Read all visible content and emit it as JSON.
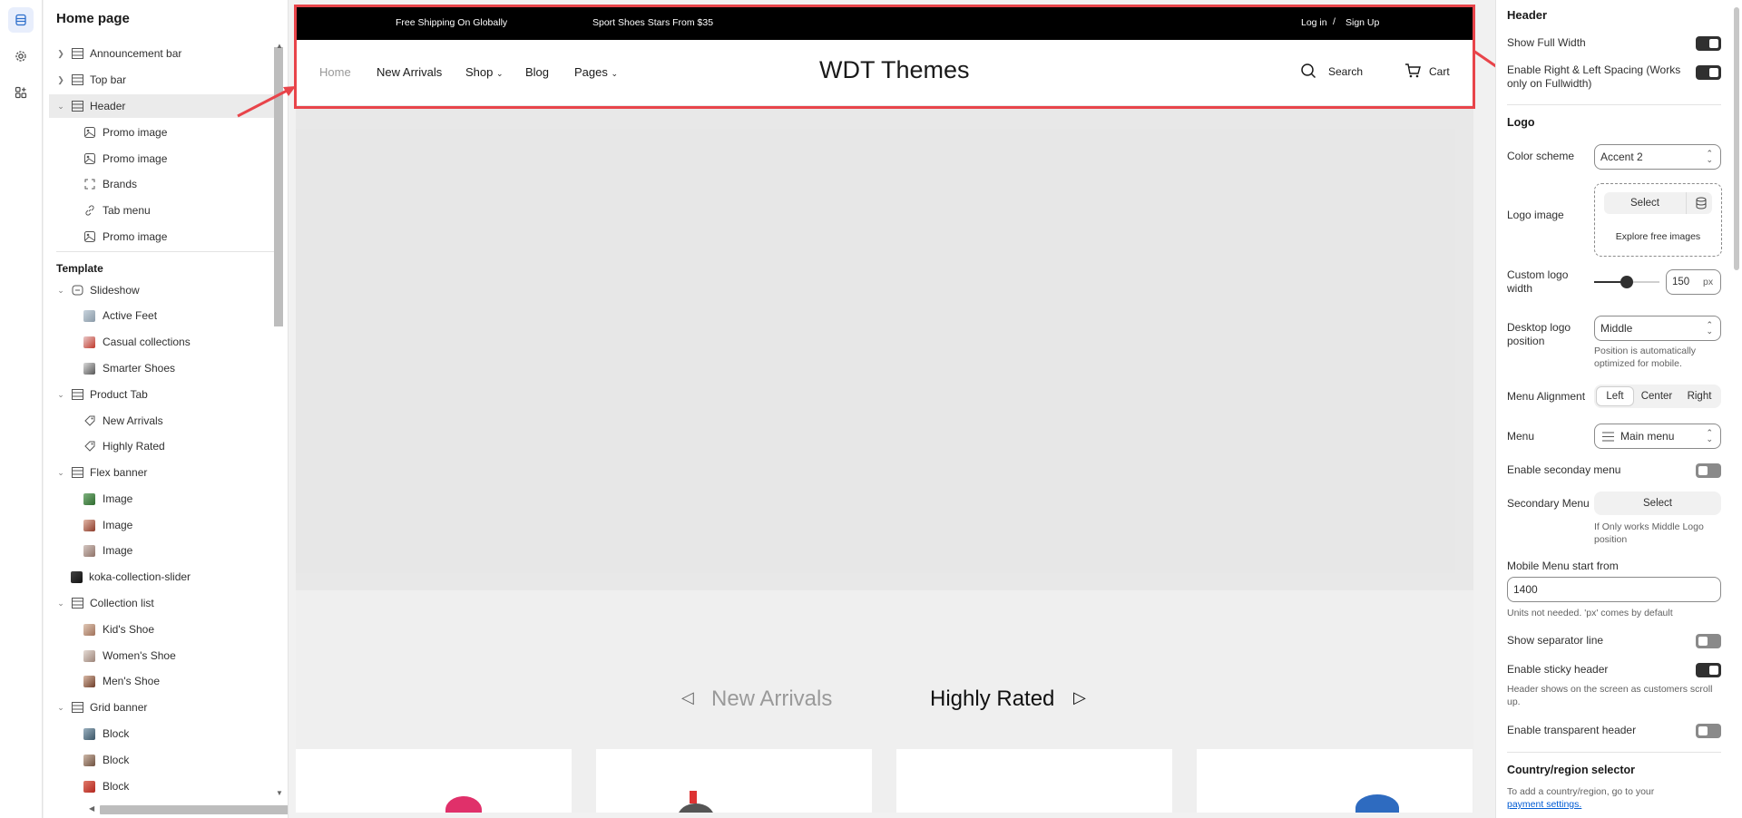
{
  "sidebar_rail": {
    "icons": [
      "sections-icon",
      "settings-gear-icon",
      "apps-icon"
    ]
  },
  "left_panel": {
    "title": "Home page",
    "header_items": [
      {
        "label": "Announcement bar"
      },
      {
        "label": "Top bar"
      },
      {
        "label": "Header"
      }
    ],
    "header_children": [
      {
        "label": "Promo image"
      },
      {
        "label": "Promo image"
      },
      {
        "label": "Brands"
      },
      {
        "label": "Tab menu"
      },
      {
        "label": "Promo image"
      }
    ],
    "template_label": "Template",
    "template_items": [
      {
        "label": "Slideshow",
        "children": [
          "Active Feet",
          "Casual collections",
          "Smarter Shoes"
        ]
      },
      {
        "label": "Product Tab",
        "children": [
          "New Arrivals",
          "Highly Rated"
        ]
      },
      {
        "label": "Flex banner",
        "children": [
          "Image",
          "Image",
          "Image"
        ]
      },
      {
        "label": "koka-collection-slider",
        "children": []
      },
      {
        "label": "Collection list",
        "children": [
          "Kid's Shoe",
          "Women's Shoe",
          "Men's Shoe"
        ]
      },
      {
        "label": "Grid banner",
        "children": [
          "Block",
          "Block",
          "Block"
        ]
      }
    ]
  },
  "preview": {
    "topbar": {
      "msg1": "Free Shipping On Globally",
      "msg2": "Sport Shoes Stars From $35",
      "login": "Log in",
      "sep": "/",
      "signup": "Sign Up"
    },
    "nav": {
      "home": "Home",
      "new_arrivals": "New Arrivals",
      "shop": "Shop",
      "blog": "Blog",
      "pages": "Pages",
      "logo": "WDT Themes",
      "search": "Search",
      "cart": "Cart"
    },
    "tabs": {
      "new_arrivals": "New Arrivals",
      "highly_rated": "Highly Rated"
    }
  },
  "right_panel": {
    "header_title": "Header",
    "show_full_width": "Show Full Width",
    "enable_spacing": "Enable Right & Left Spacing (Works only on Fullwidth)",
    "logo_title": "Logo",
    "color_scheme_label": "Color scheme",
    "color_scheme_value": "Accent 2",
    "logo_image_label": "Logo image",
    "select_btn": "Select",
    "explore_free": "Explore free images",
    "custom_logo_width_label": "Custom logo width",
    "custom_logo_width_value": "150",
    "px_unit": "px",
    "desktop_logo_position_label": "Desktop logo position",
    "desktop_logo_position_value": "Middle",
    "desktop_logo_hint": "Position is automatically optimized for mobile.",
    "menu_alignment_label": "Menu Alignment",
    "menu_alignment_options": [
      "Left",
      "Center",
      "Right"
    ],
    "menu_label": "Menu",
    "menu_value": "Main menu",
    "enable_secondary_menu": "Enable seconday menu",
    "secondary_menu_label": "Secondary Menu",
    "secondary_select": "Select",
    "secondary_hint": "If Only works Middle Logo position",
    "mobile_menu_label": "Mobile Menu start from",
    "mobile_menu_value": "1400",
    "mobile_menu_hint": "Units not needed. 'px' comes by default",
    "show_separator": "Show separator line",
    "enable_sticky": "Enable sticky header",
    "sticky_hint": "Header shows on the screen as customers scroll up.",
    "enable_transparent": "Enable transparent header",
    "country_title": "Country/region selector",
    "country_hint": "To add a country/region, go to your",
    "payment_link": "payment settings."
  }
}
